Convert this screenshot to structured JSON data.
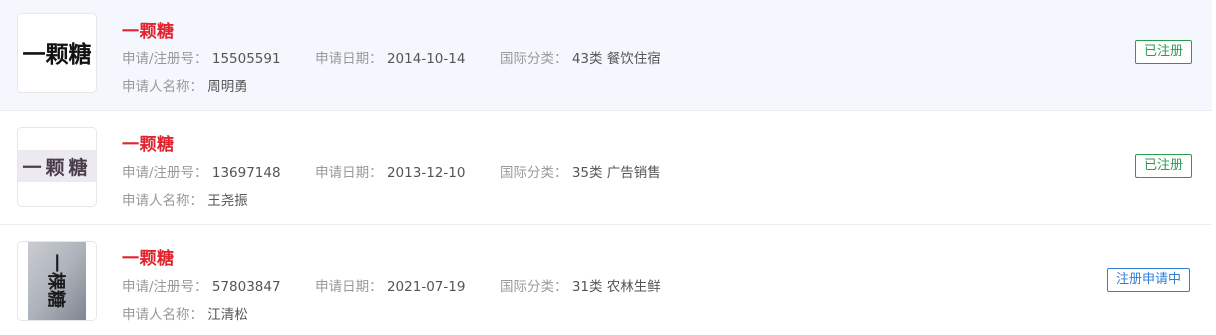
{
  "labels": {
    "reg_no": "申请/注册号：",
    "date": "申请日期：",
    "class": "国际分类：",
    "applicant": "申请人名称："
  },
  "trademarks": [
    {
      "name": "一颗糖",
      "logo_text": "一颗糖",
      "reg_no": "15505591",
      "date": "2014-10-14",
      "class": "43类 餐饮住宿",
      "applicant": "周明勇",
      "status": "已注册",
      "status_color": "#2c9a4f"
    },
    {
      "name": "一颗糖",
      "logo_text": "一颗糖",
      "reg_no": "13697148",
      "date": "2013-12-10",
      "class": "35类 广告销售",
      "applicant": "王尧振",
      "status": "已注册",
      "status_color": "#2c9a4f"
    },
    {
      "name": "一颗糖",
      "logo_text": "一棵糖",
      "reg_no": "57803847",
      "date": "2021-07-19",
      "class": "31类 农林生鲜",
      "applicant": "江清松",
      "status": "注册申请中",
      "status_color": "#2f7ed8"
    }
  ]
}
